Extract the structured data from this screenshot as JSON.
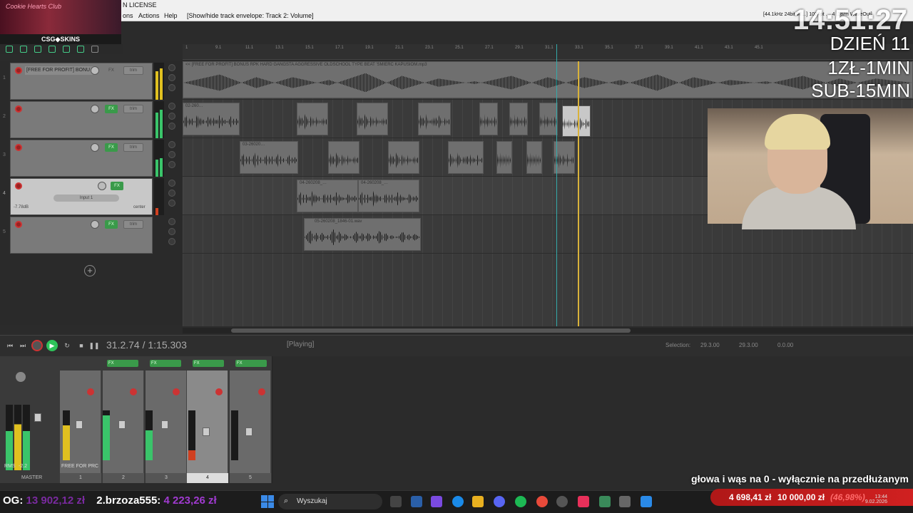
{
  "window": {
    "title": "N LICENSE",
    "menus": [
      "ons",
      "Actions",
      "Help"
    ],
    "hint": "[Show/hide track envelope: Track 2: Volume]",
    "status_right": "[44.1kHz 24bit W…] 1024pt … 4 .18/m WaveOut]"
  },
  "overlay": {
    "stream_banner_text": "Cookie Hearts Club",
    "sponsor": "CSG◆SKINS",
    "clock": "14:51:27",
    "lines": [
      "DZIEŃ 11",
      "1ZŁ-1MIN",
      "SUB-15MIN"
    ],
    "promo": "głowa i wąs na 0 - wyłącznie na przedłużanym"
  },
  "ruler": {
    "ticks": [
      "1",
      "9.1",
      "11.1",
      "13.1",
      "15.1",
      "17.1",
      "19.1",
      "21.1",
      "23.1",
      "25.1",
      "27.1",
      "29.1",
      "31.1",
      "33.1",
      "35.1",
      "37.1",
      "39.1",
      "41.1",
      "43.1",
      "45.1"
    ]
  },
  "tracks": [
    {
      "num": "1",
      "name": "[FREE FOR PROFIT] BONU",
      "fx": "FX",
      "trim": "trim"
    },
    {
      "num": "2",
      "name": "",
      "fx": "FX",
      "trim": "trim"
    },
    {
      "num": "3",
      "name": "",
      "fx": "FX",
      "trim": "trim"
    },
    {
      "num": "4",
      "name": "",
      "fx": "FX",
      "input": "Input 1",
      "vol": "-7.78dB",
      "pan": "center"
    },
    {
      "num": "5",
      "name": "",
      "fx": "FX",
      "trim": "trim"
    }
  ],
  "items": {
    "track1": "<< [FREE FOR PROFIT] BONUS RPK HARD GANGSTA AGGRESSIVE OLDSCHOOL TYPE BEAT 'ŚMIERĆ KAPUSIOM.mp3",
    "track2_first": "02-260…",
    "track3_first": "03-26020…",
    "track4_a": "04-260208_…",
    "track4_b": "04-260208_…",
    "track5": "05-260208_1846-01.wav"
  },
  "transport": {
    "time": "31.2.74 / 1:15.303",
    "state": "[Playing]",
    "selection_label": "Selection:",
    "sel_start": "29.3.00",
    "sel_end": "29.3.00",
    "sel_len": "0.0.00"
  },
  "mixer": {
    "master_label": "MASTER",
    "rms_label": "RMS",
    "rms_value": "-2.2",
    "strip_name": "FREE FOR PRC",
    "strip_numbers": [
      "1",
      "2",
      "3",
      "4",
      "5"
    ],
    "fx": "FX"
  },
  "taskbar": {
    "og_label": "OG:",
    "og_value": "13 902,12 zł",
    "top_user": "2.brzoza555:",
    "top_value": "4 223,26 zł",
    "search_placeholder": "Wyszukaj",
    "donation_current": "4 698,41 zł",
    "donation_goal": "10 000,00 zł",
    "donation_pct": "(46,98%)",
    "time": "13:44",
    "date": "9.02.2026"
  },
  "colors": {
    "accent_green": "#3a9a4a",
    "record_red": "#cc3333",
    "play_cursor": "#d9b23a"
  }
}
